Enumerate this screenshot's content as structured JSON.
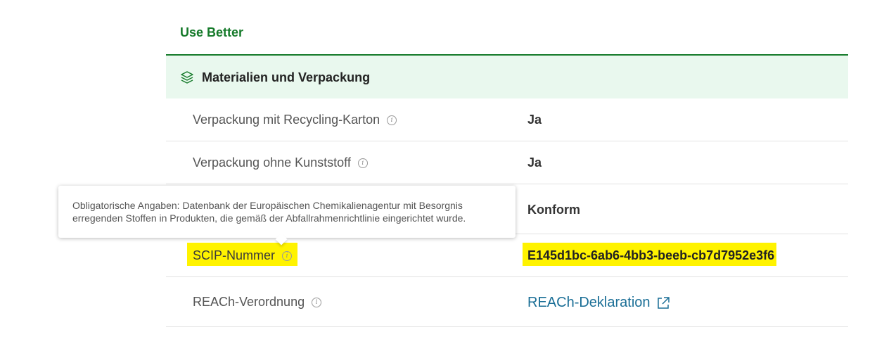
{
  "section": {
    "title": "Use Better"
  },
  "category": {
    "label": "Materialien und Verpackung",
    "icon": "layers-leaf-icon"
  },
  "rows": [
    {
      "label": "Verpackung mit Recycling-Karton",
      "value": "Ja"
    },
    {
      "label": "Verpackung ohne Kunststoff",
      "value": "Ja"
    },
    {
      "label": "",
      "value": "Konform"
    },
    {
      "label": "SCIP-Nummer",
      "value": "E145d1bc-6ab6-4bb3-beeb-cb7d7952e3f6"
    },
    {
      "label": "REACh-Verordnung",
      "value": "REACh-Deklaration"
    }
  ],
  "tooltip": {
    "text": "Obligatorische Angaben: Datenbank der Europäischen Chemikalienagentur mit Besorgnis erregenden Stoffen in Produkten, die gemäß der Abfallrahmenrichtlinie eingerichtet wurde."
  },
  "colors": {
    "accent": "#157a2a",
    "category_bg": "#e9f8ee",
    "highlight": "#fff300",
    "link": "#1a6e96"
  }
}
